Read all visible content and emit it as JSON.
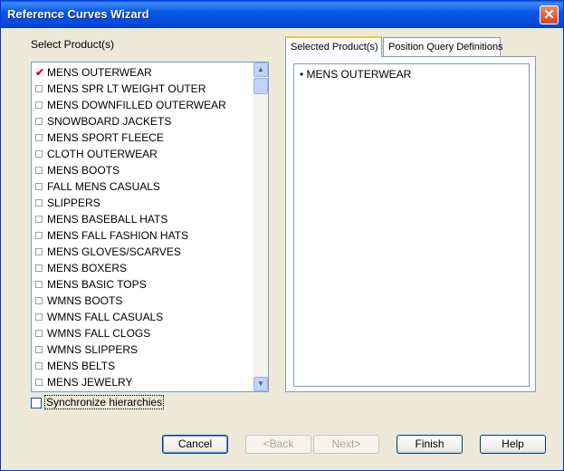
{
  "window": {
    "title": "Reference Curves Wizard",
    "close_glyph": "✕"
  },
  "left_label": "Select Product(s)",
  "products": [
    {
      "label": "MENS OUTERWEAR",
      "checked": true
    },
    {
      "label": "MENS SPR LT WEIGHT OUTER",
      "checked": false
    },
    {
      "label": "MENS DOWNFILLED OUTERWEAR",
      "checked": false
    },
    {
      "label": "SNOWBOARD JACKETS",
      "checked": false
    },
    {
      "label": "MENS SPORT FLEECE",
      "checked": false
    },
    {
      "label": "CLOTH OUTERWEAR",
      "checked": false
    },
    {
      "label": "MENS BOOTS",
      "checked": false
    },
    {
      "label": "FALL MENS CASUALS",
      "checked": false
    },
    {
      "label": "SLIPPERS",
      "checked": false
    },
    {
      "label": "MENS BASEBALL HATS",
      "checked": false
    },
    {
      "label": "MENS FALL FASHION HATS",
      "checked": false
    },
    {
      "label": "MENS GLOVES/SCARVES",
      "checked": false
    },
    {
      "label": "MENS BOXERS",
      "checked": false
    },
    {
      "label": "MENS BASIC TOPS",
      "checked": false
    },
    {
      "label": "WMNS BOOTS",
      "checked": false
    },
    {
      "label": "WMNS FALL CASUALS",
      "checked": false
    },
    {
      "label": "WMNS FALL CLOGS",
      "checked": false
    },
    {
      "label": "WMNS SLIPPERS",
      "checked": false
    },
    {
      "label": "MENS BELTS",
      "checked": false
    },
    {
      "label": "MENS JEWELRY",
      "checked": false
    }
  ],
  "sync_label": "Synchronize hierarchies",
  "tabs": [
    {
      "label": "Selected Product(s)",
      "active": true
    },
    {
      "label": "Position Query Definitions",
      "active": false
    }
  ],
  "selected_items": [
    "MENS OUTERWEAR"
  ],
  "buttons": {
    "cancel": "Cancel",
    "back": "<Back",
    "next": "Next>",
    "finish": "Finish",
    "help": "Help"
  },
  "colors": {
    "title_bar": "#0a5fe8",
    "check_mark": "#d01010",
    "tab_highlight": "#ffc83c"
  },
  "icons": {
    "close": "close-icon",
    "scroll_up": "chevron-up-icon",
    "scroll_down": "chevron-down-icon",
    "check": "check-icon"
  }
}
